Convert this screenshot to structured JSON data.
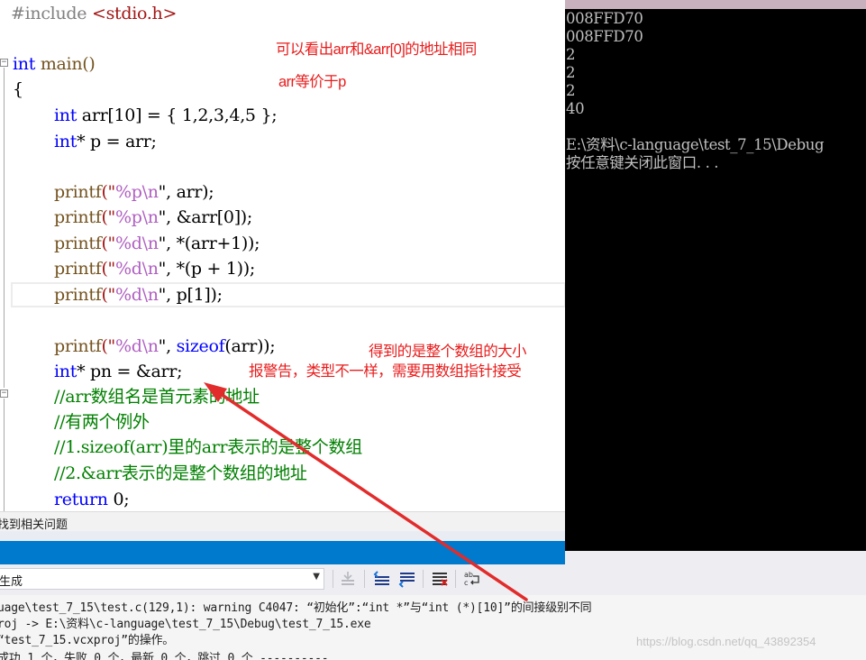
{
  "editor": {
    "lines": {
      "include_kw": "#include",
      "include_hdr": "<stdio.h>",
      "main_type": "int",
      "main_name": "main()",
      "open_brace": "{",
      "l_arr_type": "int",
      "l_arr_rest": " arr[10] = { 1,2,3,4,5 };",
      "l_p_type": "int",
      "l_p_rest": "* p = arr;",
      "printf": "printf",
      "p1_args_a": "(\"",
      "p1_fmt": "%p",
      "p1_nl": "\\n",
      "p1_tail": "\", arr);",
      "p2_tail": "\", &arr[0]);",
      "p3_fmt": "%d",
      "p3_tail": "\", *(arr+1));",
      "p4_tail": "\", *(p + 1));",
      "p5_tail": "\", p[1]);",
      "p6_sizeof": "sizeof",
      "p6_tail": "(arr));",
      "pn_type": "int",
      "pn_rest": "* pn = &arr;",
      "c1": "//arr数组名是首元素的地址",
      "c2": "//有两个例外",
      "c3": "//1.sizeof(arr)里的arr表示的是整个数组",
      "c4": "//2.&arr表示的是整个数组的地址",
      "ret_kw": "return",
      "ret_rest": " 0;"
    },
    "annotations": {
      "a1": "可以看出arr和&arr[0]的地址相同",
      "a2": "arr等价于p",
      "a3": "得到的是整个数组的大小",
      "a4": "报警告，类型不一样，需要用数组指针接受"
    }
  },
  "console": {
    "lines": [
      "008FFD70",
      "008FFD70",
      "2",
      "2",
      "2",
      "40",
      "",
      "E:\\资料\\c-language\\test_7_15\\Debug",
      "按任意键关闭此窗口. . ."
    ]
  },
  "bottom": {
    "find_related": "找到相关问题",
    "show_output_from": "生成",
    "output_lines": [
      "uage\\test_7_15\\test.c(129,1): warning C4047: “初始化”:“int *”与“int (*)[10]”的间接级别不同",
      "roj -> E:\\资料\\c-language\\test_7_15\\Debug\\test_7_15.exe",
      "“test_7_15.vcxproj”的操作。",
      "成功 1 个，失败 0 个，最新 0 个，跳过 0 个 ----------"
    ],
    "watermark": "https://blog.csdn.net/qq_43892354"
  },
  "colors": {
    "annotation": "#e81c1c",
    "arrow": "#e22b2b",
    "console_bg": "#000000",
    "status_blue": "#007acc"
  }
}
